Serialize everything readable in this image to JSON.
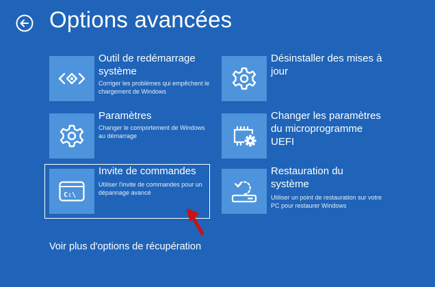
{
  "page": {
    "title": "Options avancées"
  },
  "tiles": [
    {
      "heading": "Outil de redémarrage système",
      "description": "Corriger les problèmes qui empêchent le chargement de Windows",
      "icon": "startup-repair-icon"
    },
    {
      "heading": "Désinstaller des mises à jour",
      "description": "",
      "icon": "gear-icon"
    },
    {
      "heading": "Paramètres",
      "description": "Changer le comportement de Windows au démarrage",
      "icon": "gear-icon"
    },
    {
      "heading": "Changer les paramètres du microprogramme UEFI",
      "description": "",
      "icon": "chip-gear-icon"
    },
    {
      "heading": "Invite de commandes",
      "description": "Utiliser l'invite de commandes pour un dépannage avancé",
      "icon": "command-prompt-icon",
      "prompt_text": "C:\\"
    },
    {
      "heading": "Restauration du système",
      "description": "Utiliser un point de restauration sur votre PC pour restaurer Windows",
      "icon": "system-restore-icon"
    }
  ],
  "more_options_link": "Voir plus d'options de récupération",
  "colors": {
    "background": "#1f64b8",
    "tile_icon_bg": "#4d94dc",
    "annotation_arrow": "#cc1111"
  }
}
